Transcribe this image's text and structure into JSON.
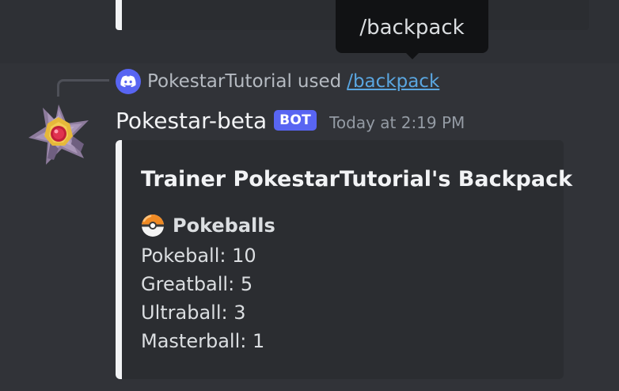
{
  "tooltip": {
    "text": "/backpack"
  },
  "reply": {
    "user": "PokestarTutorial",
    "used_text": "used",
    "command": "/backpack"
  },
  "message": {
    "username": "Pokestar-beta",
    "badge": "BOT",
    "timestamp": "Today at 2:19 PM"
  },
  "embed": {
    "title": "Trainer PokestarTutorial's Backpack",
    "field_name": "Pokeballs",
    "field_icon": "pokeball-icon",
    "lines": [
      "Pokeball: 10",
      "Greatball: 5",
      "Ultraball: 3",
      "Masterball: 1"
    ],
    "accent_color": "#f2f3f5"
  },
  "colors": {
    "background": "#313338",
    "embed_background": "#2b2d31",
    "bot_badge": "#5865f2",
    "link": "#5aa6e0"
  }
}
